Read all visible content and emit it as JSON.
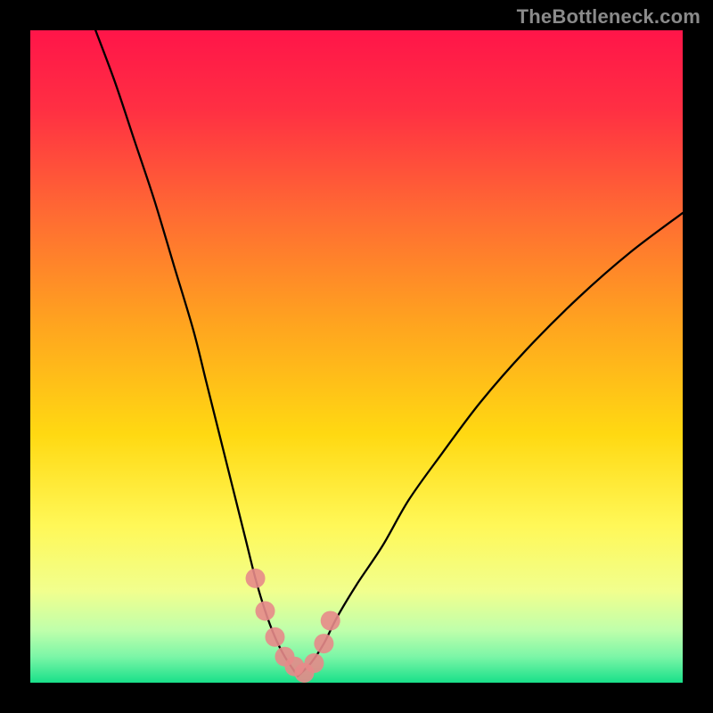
{
  "watermark": "TheBottleneck.com",
  "chart_data": {
    "type": "line",
    "title": "",
    "xlabel": "",
    "ylabel": "",
    "xlim": [
      0,
      100
    ],
    "ylim": [
      0,
      100
    ],
    "series": [
      {
        "name": "left-branch",
        "x": [
          10,
          13,
          16,
          19,
          22,
          25,
          27,
          29,
          31,
          33,
          34.5,
          36,
          37.5,
          39,
          41
        ],
        "values": [
          100,
          92,
          83,
          74,
          64,
          54,
          46,
          38,
          30,
          22,
          16,
          11,
          7,
          4,
          1
        ]
      },
      {
        "name": "right-branch",
        "x": [
          41,
          43,
          45,
          47,
          50,
          54,
          58,
          63,
          69,
          76,
          84,
          92,
          100
        ],
        "values": [
          1,
          3,
          6,
          10,
          15,
          21,
          28,
          35,
          43,
          51,
          59,
          66,
          72
        ]
      },
      {
        "name": "valley-markers",
        "x": [
          34.5,
          36,
          37.5,
          39,
          40.5,
          42,
          43.5,
          45,
          46
        ],
        "values": [
          16,
          11,
          7,
          4,
          2.5,
          1.5,
          3,
          6,
          9.5
        ]
      }
    ],
    "gradient_stops": [
      {
        "offset": 0.0,
        "color": "#ff1549"
      },
      {
        "offset": 0.12,
        "color": "#ff2f43"
      },
      {
        "offset": 0.28,
        "color": "#ff6a33"
      },
      {
        "offset": 0.45,
        "color": "#ffa41f"
      },
      {
        "offset": 0.62,
        "color": "#ffd912"
      },
      {
        "offset": 0.76,
        "color": "#fff858"
      },
      {
        "offset": 0.86,
        "color": "#f1ff8e"
      },
      {
        "offset": 0.92,
        "color": "#bfffab"
      },
      {
        "offset": 0.96,
        "color": "#7cf6a7"
      },
      {
        "offset": 1.0,
        "color": "#19e08a"
      }
    ]
  }
}
